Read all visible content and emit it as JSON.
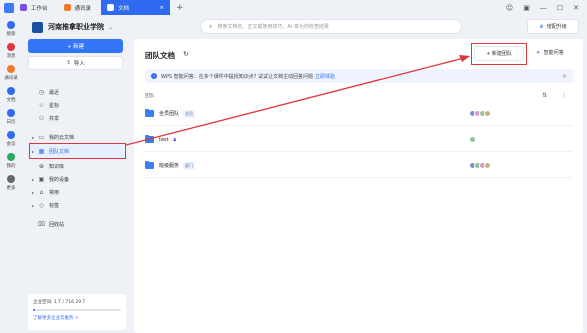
{
  "titlebar": {
    "tabs": [
      {
        "label": "工作台",
        "icon": "workbench-icon",
        "color": "#7a4de6"
      },
      {
        "label": "通讯录",
        "icon": "contacts-icon",
        "color": "#f07a28"
      },
      {
        "label": "文档",
        "icon": "doc-icon",
        "color": "#ffffff",
        "close": "×"
      }
    ],
    "plus": "+",
    "window_controls": [
      "☺",
      "▣",
      "—",
      "☐",
      "✕"
    ]
  },
  "rail": {
    "items": [
      {
        "label": "搜索",
        "color": "#2e6bf2"
      },
      {
        "label": "消息",
        "color": "#e0353b"
      },
      {
        "label": "通讯录",
        "color": "#f07a28"
      },
      {
        "label": "文档",
        "color": "#2e6bf2"
      },
      {
        "label": "日历",
        "color": "#2e6bf2"
      },
      {
        "label": "会议",
        "color": "#2e6bf2"
      },
      {
        "label": "我的",
        "color": "#2aa860"
      },
      {
        "label": "更多",
        "color": "#666666"
      }
    ],
    "badge": "2"
  },
  "org": {
    "name": "河南推拿职业学院",
    "chevron": "⌄"
  },
  "search": {
    "placeholder": "搜索文档名、正文或使用技巧，AI 将为你检查结果"
  },
  "upgrade": {
    "label": "增配升级",
    "icon": "♛"
  },
  "sidebar": {
    "new_label": "+ 新建",
    "import_label": "导入",
    "items": [
      {
        "label": "最近",
        "icon": "◷",
        "caret": ""
      },
      {
        "label": "星标",
        "icon": "☆",
        "caret": ""
      },
      {
        "label": "共享",
        "icon": "⚇",
        "caret": ""
      },
      {
        "label": "我的云文档",
        "icon": "▭",
        "caret": "▸"
      },
      {
        "label": "团队文档",
        "icon": "▦",
        "caret": "▸",
        "selected": true
      },
      {
        "label": "知识库",
        "icon": "⊕",
        "caret": ""
      },
      {
        "label": "我的设备",
        "icon": "▣",
        "caret": "▸"
      },
      {
        "label": "常用",
        "icon": "⌂",
        "caret": "▸"
      },
      {
        "label": "标签",
        "icon": "◇",
        "caret": "▸"
      },
      {
        "label": "回收站",
        "icon": "⌧",
        "caret": ""
      }
    ],
    "storage": {
      "text": "企业空间: 1 T / 716.29 T",
      "used_fraction": 0.0014,
      "link": "了解更多企业云服务 >"
    }
  },
  "main": {
    "title": "团队文档",
    "refresh_icon": "↻",
    "new_team_label": "+ 新建团队",
    "smart_q_label": "智能问答",
    "smart_q_icon": "✦",
    "banner": {
      "icon": "i",
      "text": "WPS 智能问答：在多个课件中提找知识点? 试试让文档主动回答问题",
      "link": "立即体验",
      "close": "×"
    },
    "header": {
      "col_name": "团队",
      "icons": "⇅ ⋮"
    },
    "rows": [
      {
        "name": "全员团队",
        "tag": "全员",
        "user_icon": "",
        "avatars": [
          "#7a8fd4",
          "#d99ac5",
          "#8bc79a",
          "#c9b07f"
        ]
      },
      {
        "name": "test",
        "tag": "",
        "user_icon": "♟",
        "avatars": [
          "#8bc79a"
        ]
      },
      {
        "name": "班级服务",
        "tag": "部门",
        "user_icon": "",
        "avatars": [
          "#7a8fd4",
          "#8bc79a",
          "#d99ac5",
          "#c9b07f"
        ]
      }
    ]
  },
  "colors": {
    "accent": "#2e6bf2",
    "highlight": "#e0353b"
  }
}
